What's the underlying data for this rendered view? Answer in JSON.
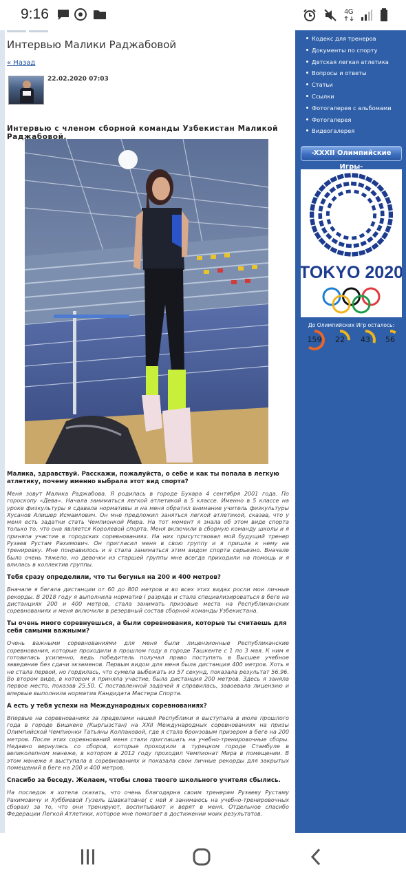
{
  "status_bar": {
    "time": "9:16",
    "network": "4G",
    "icons": [
      "message-icon",
      "chrome-icon",
      "folder-icon",
      "alarm-icon",
      "mute-icon",
      "signal-icon",
      "battery-icon"
    ]
  },
  "article": {
    "title": "Интервью Малики Раджабовой",
    "back_label": "« Назад",
    "date": "22.02.2020 07:03",
    "lead": "Интервью с членом сборной команды Узбекистан Маликой Раджабовой.",
    "qa": [
      {
        "q": "Малика, здравствуй. Расскажи, пожалуйста, о себе и как ты попала в легкую атлетику, почему именно выбрала этот вид спорта?",
        "a": "Меня зовут Малика Раджабова. Я родилась в городе Бухара 4 сентября 2001 года. По гороскопу «Дева». Начала заниматься легкой атлетикой в 5 классе. Именно в 5 классе на уроке физкультуры я сдавала нормативы и на меня обратил внимание учитель физкультуры Хусанов Алишер Исмаилович. Он мне предложил заняться легкой атлетикой, сказав, что у меня есть задатки стать Чемпионкой Мира. На тот момент я знала об этом виде спорта только то, что она является Королевой спорта. Меня включили в сборную команду школы и я приняла участие в городских соревнованиях. На них присутствовал мой будущий тренер Рузаев Рустам Рахимович. Он пригласил меня в свою группу и я пришла к нему на тренировку. Мне понравилось и я стала заниматься этим видом спорта серьезно. Вначале было очень тяжело, но девочки из старшей группы мне всегда приходили на помощь и я влилась в коллектив группы."
      },
      {
        "q": "Тебя сразу определили, что ты бегунья на 200 и 400 метров?",
        "a": "Вначале я бегала дистанции от 60 до 800 метров и во всех этих видах росли мои личные рекорды. В 2018 году я выполнила норматив I разряда и стала специализироваться в беге на дистанциях 200 и 400 метров, стала занимать призовые места на Республиканских соревнованиях и меня включили в резервный состав сборной команды Узбекистана."
      },
      {
        "q": "Ты очень много соревнуешься, а были соревнования, которые ты считаешь для себя самыми важными?",
        "a": "Очень важными соревнованиями для меня были лицензионные Республиканские соревнования, которые проходили в прошлом году в городе Ташкенте с 1 по 3 мая. К ним я готовилась усиленно, ведь победитель получал право поступать в Высшее учебное заведение без сдачи экзаменов. Первым видом для меня была дистанция 400 метров. Хоть я не стала первой, но гордилась, что сумела выбежать из 57 секунд, показала результат 56.96. Во втором виде, в котором я приняла участие, была дистанция 200 метров. Здесь я заняла первое место, показав 25.50. С поставленной задачей я справилась, завоевала лицензию и впервые выполнила норматив Кандидата Мастера Спорта."
      },
      {
        "q": "А есть у тебя успехи на Международных соревнованиях?",
        "a": "Впервые на соревнованиях за пределами нашей Республики я выступала в июле прошлого года в городе Бишкеке (Кыргызстан) на XXII Международных соревнованиях на призы Олимпийской Чемпионки Татьяны Колпаковой, где я стала бронзовым призером в беге на 200 метров. После этих соревнований меня стали приглашать на учебно-тренировочные сборы. Недавно вернулась со сборов, которые проходили в турецком городе Стамбуле в великолепном манеже, в котором в 2012 году проходил Чемпионат Мира в помещении. В этом манеже я выступала в соревнованиях и показала свои личные рекорды для закрытых помещений в беге на 200 и 400 метров."
      },
      {
        "q": "Спасибо за беседу. Желаем, чтобы слова твоего школьного учителя сбылись.",
        "a": "На последок я хотела сказать, что очень благодарна своим тренерам Рузаеву Рустаму Рахимовичу и Хуббиевой Гузель Шавкатовне( с ней я занимаюсь на учебно-тренировочных сборах) за то, что они тренируют, воспитывают и верят в меня. Отдельное спасибо Федерации Легкой Атлетики, которое мне помогает в достижении моих результатов."
      }
    ]
  },
  "sidebar": {
    "menu": [
      "Кодекс для тренеров",
      "Документы по спорту",
      "Детская легкая атлетика",
      "Вопросы и ответы",
      "Статьи",
      "Ссылки",
      "Фотогалерея с альбомами",
      "Фотогалерея",
      "Видеогалерея"
    ],
    "olympic_button": "-XXXII Олимпийские Игры-",
    "tokyo_text": "TOKYO 2020",
    "countdown_label": "До Олимпийских Игр осталось:",
    "countdown": [
      {
        "value": "159",
        "color": "#e8662a",
        "fill": 0.6
      },
      {
        "value": "22",
        "color": "#f1b51c",
        "fill": 0.25
      },
      {
        "value": "43",
        "color": "#f1b51c",
        "fill": 0.3
      },
      {
        "value": "56",
        "color": "#f1b51c",
        "fill": 0.1
      }
    ]
  },
  "nav_bar": {
    "buttons": [
      "recents-button",
      "home-button",
      "back-button"
    ]
  }
}
